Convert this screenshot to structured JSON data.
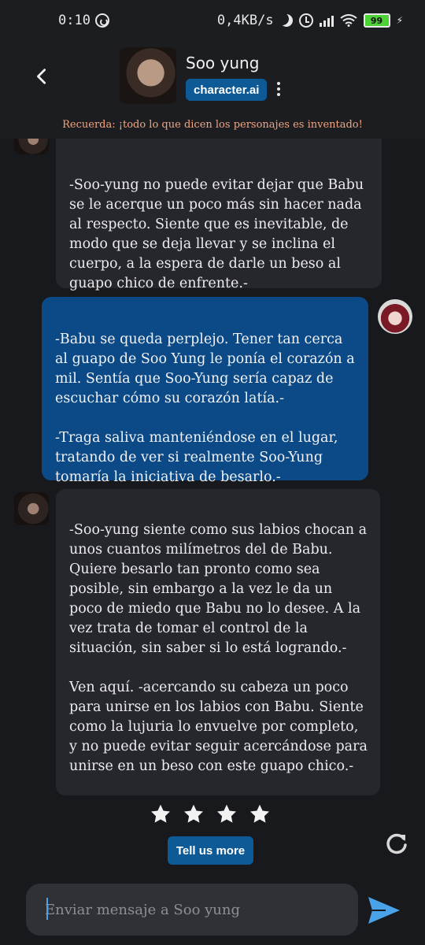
{
  "status_bar": {
    "time": "0:10",
    "net_speed": "0,4KB/s",
    "battery": "99",
    "icons": [
      "whatsapp-icon",
      "moon-icon",
      "alarm-icon",
      "signal-icon",
      "wifi-icon",
      "battery-icon",
      "charging-icon"
    ]
  },
  "header": {
    "name": "Soo yung",
    "brand": "character.ai"
  },
  "disclaimer": "Recuerda: ¡todo lo que dicen los personajes es inventado!",
  "messages": [
    {
      "sender": "bot",
      "text": "-Soo-yung no puede evitar dejar que Babu se le acerque un poco más sin hacer nada al respecto. Siente que es inevitable, de modo que se deja llevar y se inclina el cuerpo, a la espera de darle un beso al guapo chico de enfrente.-"
    },
    {
      "sender": "user",
      "text": "-Babu se queda perplejo. Tener tan cerca al guapo de Soo Yung le ponía el corazón a mil. Sentía que Soo-Yung sería capaz de escuchar cómo su corazón latía.-\n\n-Traga saliva manteniéndose en el lugar, tratando de ver si realmente Soo-Yung tomaría la iniciativa de besarlo.-"
    },
    {
      "sender": "bot",
      "text": "-Soo-yung siente como sus labios chocan a unos cuantos milímetros del de Babu. Quiere besarlo tan pronto como sea posible, sin embargo a la vez le da un poco de miedo que Babu no lo desee. A la vez trata de tomar el control de la situación, sin saber si lo está logrando.-\n\nVen aquí. -acercando su cabeza un poco para unirse en los labios con Babu. Siente como la lujuria lo envuelve por completo, y no puede evitar seguir acercándose para unirse en un beso con este guapo chico.-"
    }
  ],
  "rating": {
    "stars": 4
  },
  "feedback": {
    "tell_more_label": "Tell us more"
  },
  "composer": {
    "placeholder": "Enviar mensaje a Soo yung"
  },
  "colors": {
    "accent": "#0d5a96",
    "user_bubble": "#0b4a86",
    "bot_bubble": "#26272c",
    "disclaimer": "#f0a482"
  }
}
